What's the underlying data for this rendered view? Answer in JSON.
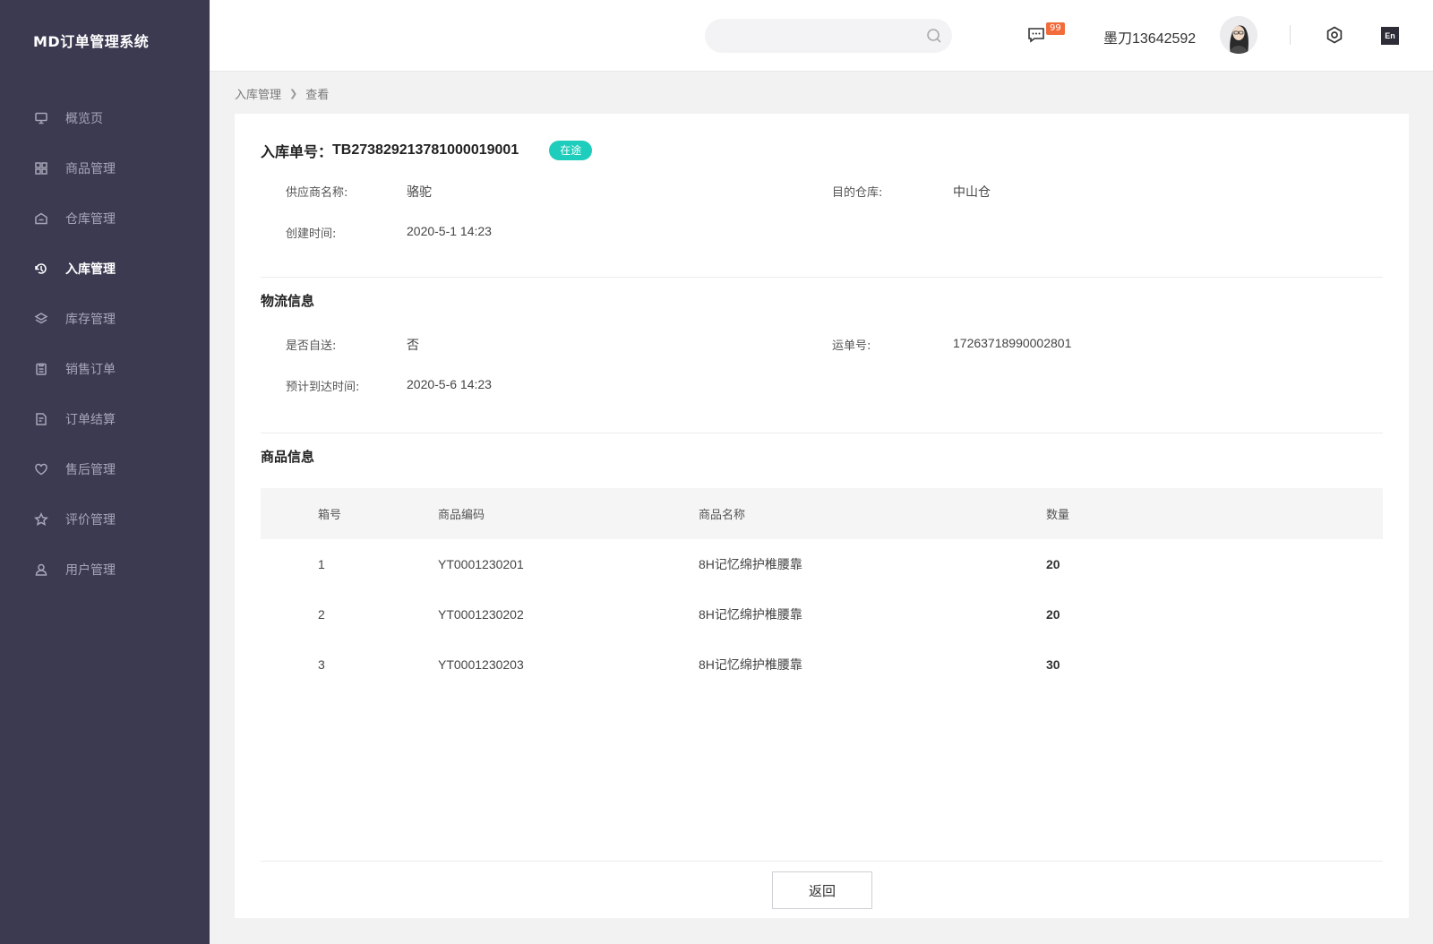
{
  "app": {
    "brand": "MD订单管理系统"
  },
  "sidebar": {
    "items": [
      {
        "label": "概览页",
        "icon": "monitor-icon"
      },
      {
        "label": "商品管理",
        "icon": "grid-icon"
      },
      {
        "label": "仓库管理",
        "icon": "warehouse-icon"
      },
      {
        "label": "入库管理",
        "icon": "inbound-icon",
        "active": true
      },
      {
        "label": "库存管理",
        "icon": "layers-icon"
      },
      {
        "label": "销售订单",
        "icon": "clipboard-icon"
      },
      {
        "label": "订单结算",
        "icon": "settlement-icon"
      },
      {
        "label": "售后管理",
        "icon": "heart-icon"
      },
      {
        "label": "评价管理",
        "icon": "star-icon"
      },
      {
        "label": "用户管理",
        "icon": "user-icon"
      }
    ]
  },
  "header": {
    "search_placeholder": "",
    "message_count": "99",
    "username": "墨刀13642592",
    "lang_label": "En"
  },
  "breadcrumb": {
    "parent": "入库管理",
    "current": "查看"
  },
  "order": {
    "title_prefix": "入库单号：",
    "number": "TB273829213781000019001",
    "status": "在途",
    "status_color": "#1ecdbb"
  },
  "basic": {
    "supplier_label": "供应商名称:",
    "supplier_value": "骆驼",
    "warehouse_label": "目的仓库:",
    "warehouse_value": "中山仓",
    "created_label": "创建时间:",
    "created_value": "2020-5-1 14:23"
  },
  "logistics": {
    "section_title": "物流信息",
    "self_delivery_label": "是否自送:",
    "self_delivery_value": "否",
    "waybill_label": "运单号:",
    "waybill_value": "17263718990002801",
    "eta_label": "预计到达时间:",
    "eta_value": "2020-5-6 14:23"
  },
  "goods": {
    "section_title": "商品信息",
    "columns": [
      "箱号",
      "商品编码",
      "商品名称",
      "数量"
    ],
    "rows": [
      [
        "1",
        "YT0001230201",
        "8H记忆绵护椎腰靠",
        "20"
      ],
      [
        "2",
        "YT0001230202",
        "8H记忆绵护椎腰靠",
        "20"
      ],
      [
        "3",
        "YT0001230203",
        "8H记忆绵护椎腰靠",
        "30"
      ]
    ]
  },
  "actions": {
    "back_label": "返回"
  },
  "colors": {
    "sidebar_bg": "#3b3a51",
    "badge": "#f26b3a",
    "accent": "#1ecdbb"
  }
}
